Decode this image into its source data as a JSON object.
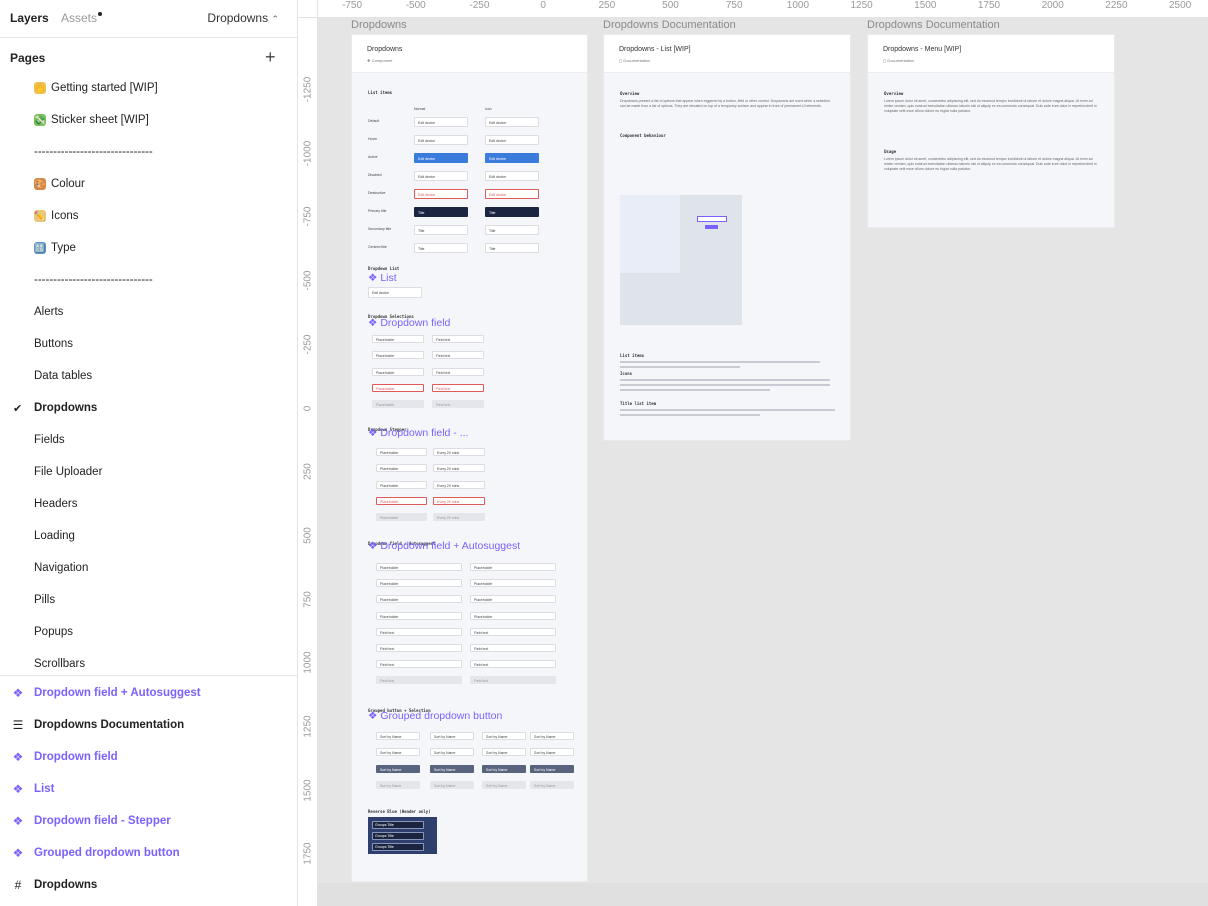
{
  "sidebar": {
    "tabs": {
      "layers": "Layers",
      "assets": "Assets"
    },
    "current_page": "Dropdowns",
    "pages_heading": "Pages",
    "pages": [
      {
        "label": "Getting started [WIP]",
        "emoji": "👋",
        "color": "#f2c14e"
      },
      {
        "label": "Sticker sheet [WIP]",
        "emoji": "💸",
        "color": "#7bbf5e"
      },
      {
        "label": "-------------------------------"
      },
      {
        "label": "Colour",
        "emoji": "🎨",
        "color": "#d18a4c"
      },
      {
        "label": "Icons",
        "emoji": "✏️",
        "color": "#e9c77a"
      },
      {
        "label": "Type",
        "emoji": "🔠",
        "color": "#5b8fd6"
      },
      {
        "label": "-------------------------------"
      },
      {
        "label": "Alerts"
      },
      {
        "label": "Buttons"
      },
      {
        "label": "Data tables"
      },
      {
        "label": "Dropdowns",
        "current": true
      },
      {
        "label": "Fields"
      },
      {
        "label": "File Uploader"
      },
      {
        "label": "Headers"
      },
      {
        "label": "Loading"
      },
      {
        "label": "Navigation"
      },
      {
        "label": "Pills"
      },
      {
        "label": "Popups"
      },
      {
        "label": "Scrollbars"
      }
    ],
    "layers": [
      {
        "label": "Dropdown field + Autosuggest",
        "type": "component"
      },
      {
        "label": "Dropdowns Documentation",
        "type": "section"
      },
      {
        "label": "Dropdown field",
        "type": "component"
      },
      {
        "label": "List",
        "type": "component"
      },
      {
        "label": "Dropdown field - Stepper",
        "type": "component"
      },
      {
        "label": "Grouped dropdown button",
        "type": "component"
      },
      {
        "label": "Dropdowns",
        "type": "frame"
      }
    ]
  },
  "canvas": {
    "ruler_x": [
      "-750",
      "-500",
      "-250",
      "0",
      "250",
      "500",
      "750",
      "1000",
      "1250",
      "1500",
      "1750",
      "2000",
      "2250",
      "2500"
    ],
    "ruler_y": [
      "-1250",
      "-1000",
      "-750",
      "-500",
      "-250",
      "0",
      "250",
      "500",
      "750",
      "1000",
      "1250",
      "1500",
      "1750"
    ],
    "frame_labels": {
      "main": "Dropdowns",
      "doc1": "Dropdowns Documentation",
      "doc2": "Dropdowns Documentation"
    },
    "main_frame": {
      "title": "Dropdowns",
      "subtitle": "❖ Component",
      "sections": {
        "list_items": "List items",
        "dropdown_list": "Dropdown List",
        "dropdown_selections": "Dropdown Selections",
        "dropdown_stepper": "Dropdown Stepper",
        "dropdown_autosuggest": "Dropdown field + Autosuggest",
        "grouped": "Grouped button + Selection",
        "reverse": "Reverse Blue (Header only)"
      },
      "components": {
        "list": "❖ List",
        "dropdown_field": "❖ Dropdown field",
        "dropdown_stepper": "❖ Dropdown field - ...",
        "autosuggest": "❖ Dropdown field + Autosuggest",
        "grouped": "❖ Grouped dropdown button"
      },
      "row_labels": [
        "Default",
        "Hover",
        "Active",
        "Disabled",
        "Destructive",
        "Primary title",
        "Secondary title",
        "Centred title"
      ],
      "col_headers": [
        "Normal",
        "Icon"
      ],
      "cell_text": "Edit device",
      "title_text": "Title",
      "placeholder": "Placeholder",
      "field_text": "Field text",
      "stepper_text": "Every 20 mins",
      "sort_text": "Sort by Name",
      "error_text": "Error message",
      "group_text": "Groups Title"
    },
    "doc1": {
      "title": "Dropdowns - List [WIP]",
      "subtitle": "◻ Documentation",
      "headings": [
        "Overview",
        "Usage",
        "Component behaviour",
        "List items",
        "Icons",
        "Title list item"
      ],
      "body": "Dropdowns present a list of options that appear when triggered by a button, field or other control. Dropdowns are used when a selection can be made from a list of options. They are elevated on top of a temporary surface and appear in front of permanent UI elements."
    },
    "doc2": {
      "title": "Dropdowns - Menu [WIP]",
      "subtitle": "◻ Documentation",
      "headings": [
        "Overview",
        "Usage"
      ],
      "body": "Lorem ipsum dolor sit amet, consectetur adipiscing elit, sed do eiusmod tempor incididunt ut labore et dolore magna aliqua. Ut enim ad minim veniam, quis nostrud exercitation ullamco laboris nisi ut aliquip ex ea commodo consequat. Duis aute irure dolor in reprehenderit in voluptate velit esse cillum dolore eu fugiat nulla pariatur."
    },
    "colors": {
      "accent": "#7b61ff",
      "active_blue": "#3b7bdc",
      "navy": "#1c2540",
      "error": "#e15a5a"
    }
  }
}
